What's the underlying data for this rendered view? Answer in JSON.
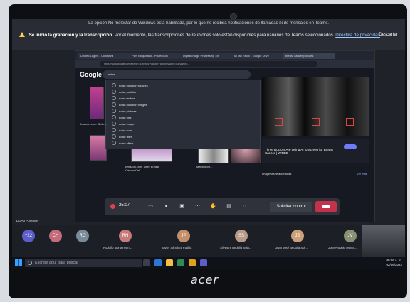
{
  "notices": {
    "dnd": "La opción No molestar de Windows está habilitada, por lo que no recibirá notificaciones de llamadas ni de mensajes en Teams.",
    "recording_bold": "Se inició la grabación y la transcripción.",
    "recording_text": "Por el momento, las transcripciones de reuniones solo están disponibles para usuarios de Teams seleccionados.",
    "privacy_link": "Directiva de privacidad",
    "dismiss": "Descartar"
  },
  "browser": {
    "tabs": [
      "Unified Logins - Cobranza",
      "PDF Bloqueado - Proteccion",
      "Digital Image Processing 4th",
      "Mi lab Rakhi - Google Drive",
      "breast cancer pictures"
    ],
    "address": "https://www.google.com/search?q=breast+cancer+pictures&tbm=isch&ved=..."
  },
  "google": {
    "logo": "Google",
    "query": "noise",
    "suggestions": [
      "noise pollution pictures",
      "noise pollution",
      "noise texture",
      "noise pollution images",
      "noise pictures",
      "noise png",
      "noise image",
      "noise icon",
      "noise filter",
      "noise effect"
    ],
    "captions": [
      "Amazon.com: Seife...",
      "Amazon.com: Seife Breast Cancer Cell...",
      "Menn dorp...",
      "Three Doctors Are Using AI to Screen for Breast Cancer | WIRED"
    ],
    "images_related": "Imágenes relacionadas",
    "see_more": "Ver más"
  },
  "meeting": {
    "timer": "25:07",
    "stop_control": "Solicitar control",
    "presenter": "DDA3 Ponente"
  },
  "participants": [
    {
      "initials": "+22",
      "name": "",
      "color": "#5b5fc7"
    },
    {
      "initials": "CH",
      "name": "",
      "color": "#c46c7a"
    },
    {
      "initials": "RO",
      "name": "",
      "color": "#7a8a99"
    },
    {
      "initials": "RH",
      "name": "Rodolfo Montenegro...",
      "color": "#c67a7a"
    },
    {
      "initials": "JP",
      "name": "Javier Sánchez Padilla",
      "color": "#c38f6a"
    },
    {
      "initials": "SS",
      "name": "Silvestre Bedolla Sola...",
      "color": "#b89a88"
    },
    {
      "initials": "JS",
      "name": "Juan José Bedolla Sol...",
      "color": "#c9a079"
    },
    {
      "initials": "JV",
      "name": "Jose Antonio Monte...",
      "color": "#8a8f73"
    }
  ],
  "taskbar": {
    "search_placeholder": "Escribe aquí para buscar",
    "time": "09:26 a. m.",
    "date": "02/08/2022"
  },
  "device": {
    "brand": "acer"
  }
}
